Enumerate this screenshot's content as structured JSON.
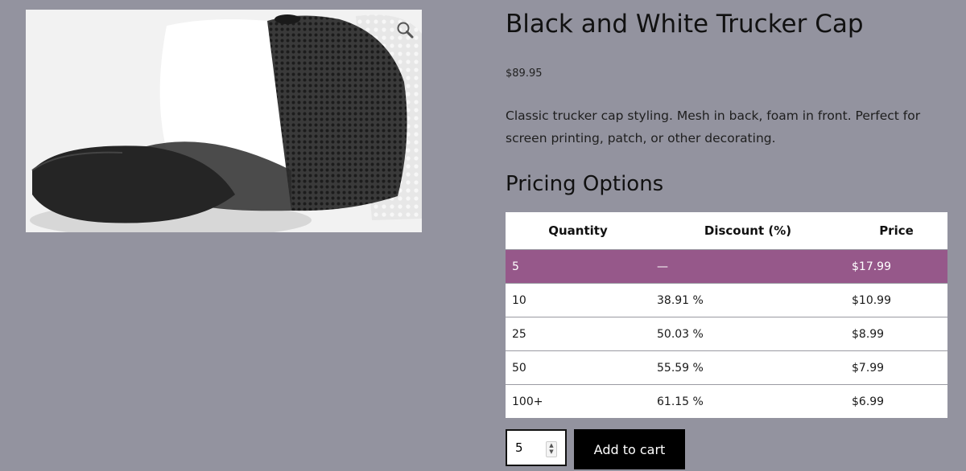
{
  "product": {
    "title": "Black and White Trucker Cap",
    "price": "$89.95",
    "description": "Classic trucker cap styling. Mesh in back, foam in front. Perfect for screen printing, patch, or other decorating.",
    "image_icon": "trucker-cap-image",
    "zoom_icon": "magnifier-icon"
  },
  "pricing": {
    "title": "Pricing Options",
    "headers": {
      "quantity": "Quantity",
      "discount": "Discount (%)",
      "price": "Price"
    },
    "rows": [
      {
        "quantity": "5",
        "discount": "—",
        "price": "$17.99"
      },
      {
        "quantity": "10",
        "discount": "38.91 %",
        "price": "$10.99"
      },
      {
        "quantity": "25",
        "discount": "50.03 %",
        "price": "$8.99"
      },
      {
        "quantity": "50",
        "discount": "55.59 %",
        "price": "$7.99"
      },
      {
        "quantity": "100+",
        "discount": "61.15 %",
        "price": "$6.99"
      }
    ],
    "active_color": "#96588a"
  },
  "cart": {
    "quantity_value": "5",
    "add_label": "Add to cart"
  }
}
